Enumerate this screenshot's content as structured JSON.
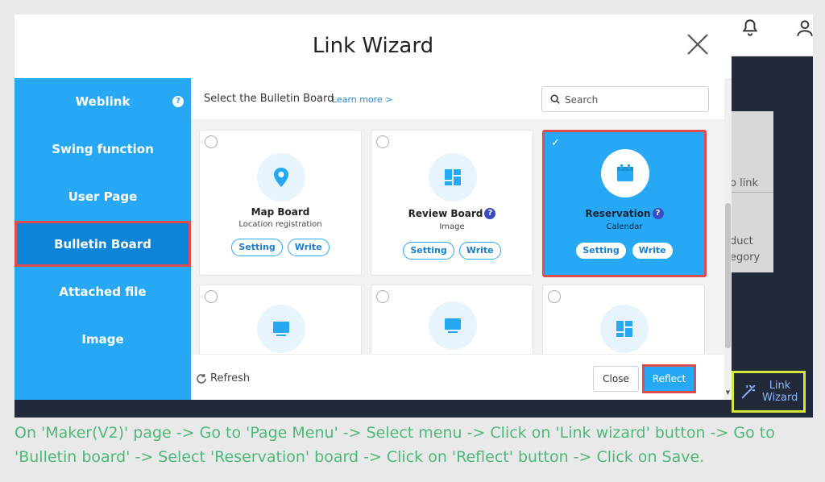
{
  "modal": {
    "title": "Link Wizard",
    "sidebar": [
      {
        "label": "Weblink",
        "help": "?"
      },
      {
        "label": "Swing function"
      },
      {
        "label": "User Page"
      },
      {
        "label": "Bulletin Board",
        "active": true
      },
      {
        "label": "Attached file"
      },
      {
        "label": "Image"
      }
    ],
    "content": {
      "select_label": "Select the Bulletin Board",
      "learn_more": "Learn more >",
      "search_placeholder": "Search",
      "cards": [
        {
          "name": "Map Board",
          "sub": "Location registration",
          "icon": "location-pin-icon",
          "setting": "Setting",
          "write": "Write"
        },
        {
          "name": "Review Board",
          "badge": "?",
          "sub": "Image",
          "icon": "layout-grid-icon",
          "setting": "Setting",
          "write": "Write"
        },
        {
          "name": "Reservation",
          "badge": "?",
          "sub": "Calendar",
          "icon": "calendar-icon",
          "setting": "Setting",
          "write": "Write",
          "selected": true
        },
        {
          "icon": "monitor-icon"
        },
        {
          "icon": "monitor-icon"
        },
        {
          "icon": "layout-grid-icon"
        }
      ],
      "refresh": "Refresh",
      "close": "Close",
      "reflect": "Reflect"
    }
  },
  "background": {
    "panel_text_1": "o link",
    "panel_text_2": "duct",
    "panel_text_3": "egory",
    "bottom_text": "",
    "link_wizard_label": "Link\nWizard"
  },
  "caption": "On 'Maker(V2)' page -> Go to 'Page Menu' -> Select menu -> Click on 'Link wizard' button -> Go to 'Bulletin board' -> Select 'Reservation' board -> Click on 'Reflect' button -> Click on Save.",
  "colors": {
    "sidebar": "#26a8f5",
    "sidebar_active": "#0d84d8",
    "highlight": "#e04c4c",
    "caption": "#4db87a",
    "link_wizard_border": "#d7e83a"
  }
}
